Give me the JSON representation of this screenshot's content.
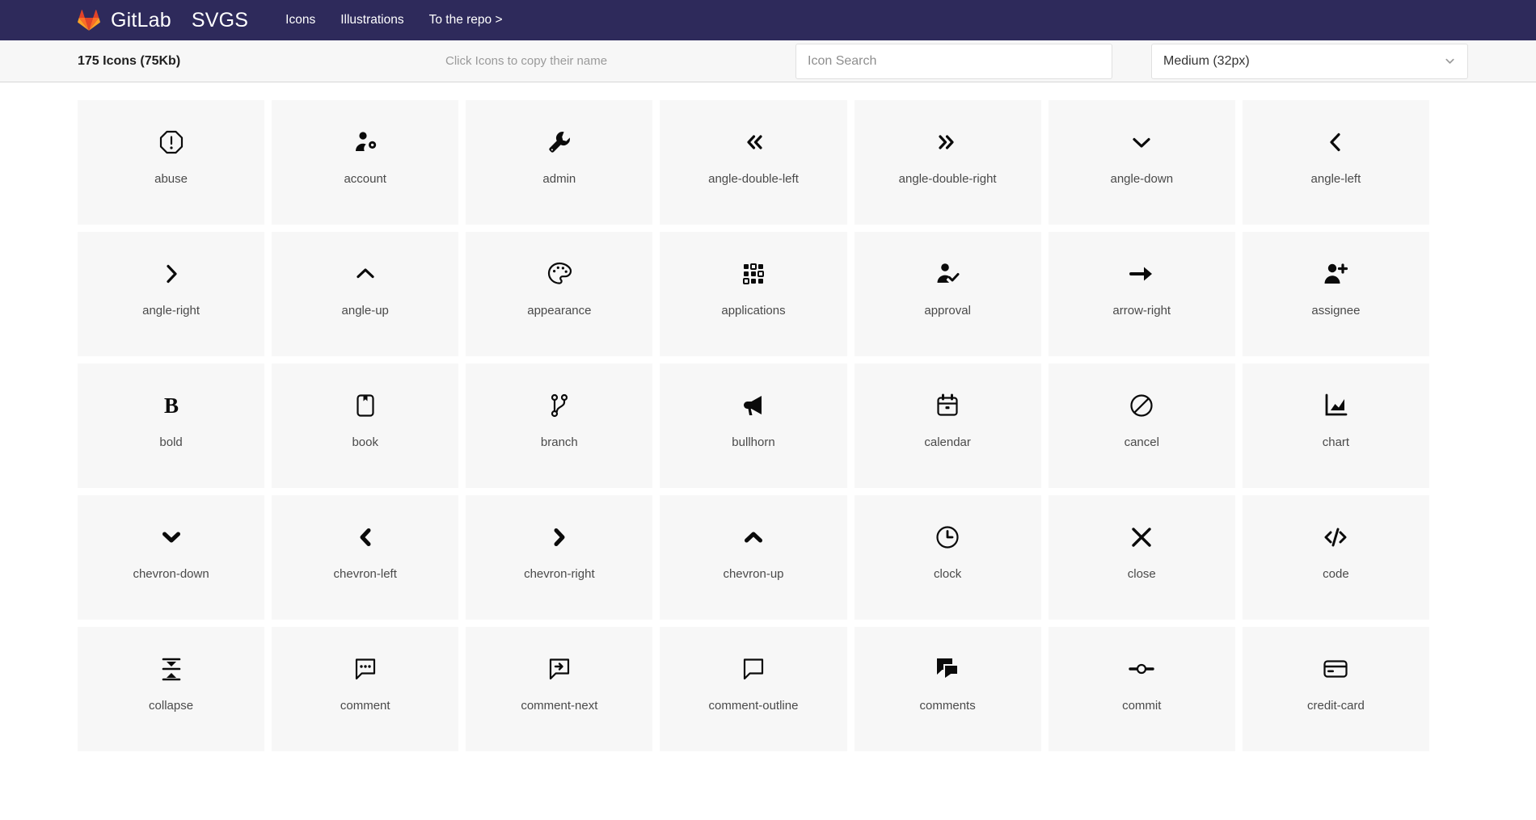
{
  "navbar": {
    "logo_icon": "gitlab-tanuki-logo",
    "brand": "GitLab",
    "brand_suffix": "SVGS",
    "links": [
      {
        "label": "Icons",
        "name": "nav-link-icons"
      },
      {
        "label": "Illustrations",
        "name": "nav-link-illustrations"
      },
      {
        "label": "To the repo >",
        "name": "nav-link-repo"
      }
    ]
  },
  "toolbar": {
    "count_text": "175 Icons (75Kb)",
    "hint": "Click Icons to copy their name",
    "search_placeholder": "Icon Search",
    "search_value": "",
    "size_selected": "Medium (32px)",
    "size_options": [
      "Medium (32px)"
    ],
    "chevron_icon": "chevron-down-icon"
  },
  "colors": {
    "navbar_bg": "#2e2a5b",
    "toolbar_bg": "#f7f7f7",
    "cell_bg": "#f7f7f7",
    "icon_color": "#0b0b0b",
    "label_color": "#4a4a4a",
    "logo_orange": "#fc6d26",
    "logo_dark_orange": "#e24329",
    "logo_light_orange": "#fca326"
  },
  "icons": [
    {
      "name": "abuse",
      "glyph": "abuse-icon"
    },
    {
      "name": "account",
      "glyph": "account-icon"
    },
    {
      "name": "admin",
      "glyph": "wrench-icon"
    },
    {
      "name": "angle-double-left",
      "glyph": "angle-double-left-icon"
    },
    {
      "name": "angle-double-right",
      "glyph": "angle-double-right-icon"
    },
    {
      "name": "angle-down",
      "glyph": "angle-down-icon"
    },
    {
      "name": "angle-left",
      "glyph": "angle-left-icon"
    },
    {
      "name": "angle-right",
      "glyph": "angle-right-icon"
    },
    {
      "name": "angle-up",
      "glyph": "angle-up-icon"
    },
    {
      "name": "appearance",
      "glyph": "palette-icon"
    },
    {
      "name": "applications",
      "glyph": "grid-dots-icon"
    },
    {
      "name": "approval",
      "glyph": "user-check-icon"
    },
    {
      "name": "arrow-right",
      "glyph": "arrow-right-icon"
    },
    {
      "name": "assignee",
      "glyph": "user-plus-icon"
    },
    {
      "name": "bold",
      "glyph": "bold-icon"
    },
    {
      "name": "book",
      "glyph": "book-icon"
    },
    {
      "name": "branch",
      "glyph": "branch-icon"
    },
    {
      "name": "bullhorn",
      "glyph": "bullhorn-icon"
    },
    {
      "name": "calendar",
      "glyph": "calendar-icon"
    },
    {
      "name": "cancel",
      "glyph": "cancel-icon"
    },
    {
      "name": "chart",
      "glyph": "chart-icon"
    },
    {
      "name": "chevron-down",
      "glyph": "chevron-down-icon"
    },
    {
      "name": "chevron-left",
      "glyph": "chevron-left-icon"
    },
    {
      "name": "chevron-right",
      "glyph": "chevron-right-icon"
    },
    {
      "name": "chevron-up",
      "glyph": "chevron-up-icon"
    },
    {
      "name": "clock",
      "glyph": "clock-icon"
    },
    {
      "name": "close",
      "glyph": "close-icon"
    },
    {
      "name": "code",
      "glyph": "code-icon"
    },
    {
      "name": "collapse",
      "glyph": "collapse-icon"
    },
    {
      "name": "comment",
      "glyph": "comment-dots-icon"
    },
    {
      "name": "comment-next",
      "glyph": "comment-next-icon"
    },
    {
      "name": "comment-outline",
      "glyph": "comment-outline-icon"
    },
    {
      "name": "comments",
      "glyph": "comments-icon"
    },
    {
      "name": "commit",
      "glyph": "commit-icon"
    },
    {
      "name": "credit-card",
      "glyph": "credit-card-icon"
    }
  ]
}
